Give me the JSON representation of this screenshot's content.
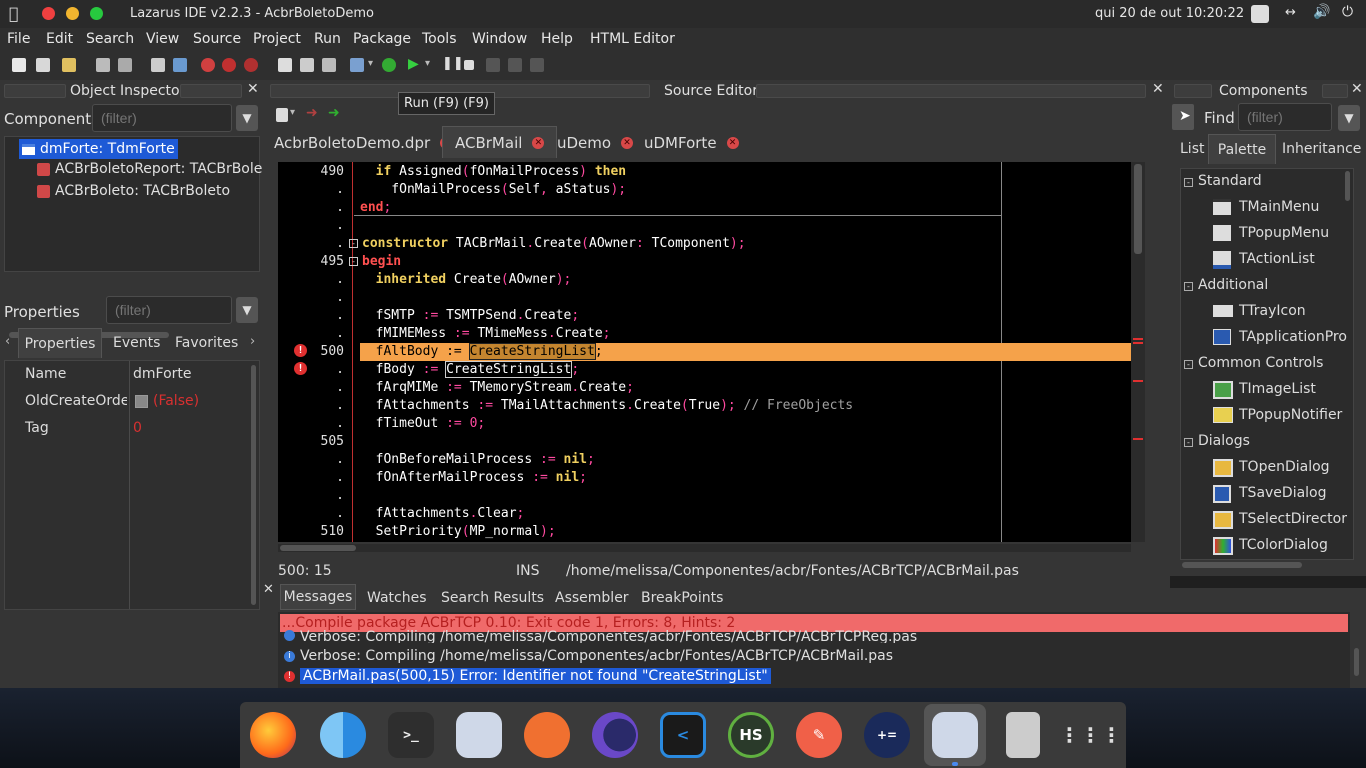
{
  "system": {
    "title": "Lazarus IDE v2.2.3 - AcbrBoletoDemo",
    "datetime": "qui 20 de out  10:20:22"
  },
  "menu": [
    "File",
    "Edit",
    "Search",
    "View",
    "Source",
    "Project",
    "Run",
    "Package",
    "Tools",
    "Window",
    "Help",
    "HTML Editor"
  ],
  "tooltip": "Run (F9) (F9)",
  "object_inspector": {
    "title": "Object Inspector",
    "components_label": "Components",
    "filter_placeholder": "(filter)",
    "tree": [
      "dmForte: TdmForte",
      "ACBrBoletoReport: TACBrBole",
      "ACBrBoleto: TACBrBoleto"
    ],
    "properties_label": "Properties",
    "tabs": [
      "Properties",
      "Events",
      "Favorites"
    ],
    "props": [
      {
        "name": "Name",
        "value": "dmForte"
      },
      {
        "name": "OldCreateOrder",
        "value": "(False)"
      },
      {
        "name": "Tag",
        "value": "0"
      }
    ]
  },
  "source_editor": {
    "title": "Source Editor",
    "tabs": [
      "AcbrBoletoDemo.dpr",
      "ACBrMail",
      "uDemo",
      "uDMForte"
    ],
    "lines": [
      {
        "n": "490",
        "t": "  if Assigned(fOnMailProcess) then"
      },
      {
        "n": ".",
        "t": "    fOnMailProcess(Self, aStatus);"
      },
      {
        "n": ".",
        "t": "end;"
      },
      {
        "n": ".",
        "t": ""
      },
      {
        "n": ".",
        "t": "constructor TACBrMail.Create(AOwner: TComponent);"
      },
      {
        "n": "495",
        "t": "begin"
      },
      {
        "n": ".",
        "t": "  inherited Create(AOwner);"
      },
      {
        "n": ".",
        "t": ""
      },
      {
        "n": ".",
        "t": "  fSMTP := TSMTPSend.Create;"
      },
      {
        "n": ".",
        "t": "  fMIMEMess := TMimeMess.Create;"
      },
      {
        "n": "500",
        "t": "  fAltBody := CreateStringList;"
      },
      {
        "n": ".",
        "t": "  fBody := CreateStringList;"
      },
      {
        "n": ".",
        "t": "  fArqMIMe := TMemoryStream.Create;"
      },
      {
        "n": ".",
        "t": "  fAttachments := TMailAttachments.Create(True); // FreeObjects"
      },
      {
        "n": ".",
        "t": "  fTimeOut := 0;"
      },
      {
        "n": "505",
        "t": ""
      },
      {
        "n": ".",
        "t": "  fOnBeforeMailProcess := nil;"
      },
      {
        "n": ".",
        "t": "  fOnAfterMailProcess := nil;"
      },
      {
        "n": ".",
        "t": ""
      },
      {
        "n": ".",
        "t": "  fAttachments.Clear;"
      },
      {
        "n": "510",
        "t": "  SetPriority(MP_normal);"
      }
    ],
    "status_pos": "500: 15",
    "status_mode": "INS",
    "status_file": "/home/melissa/Componentes/acbr/Fontes/ACBrTCP/ACBrMail.pas"
  },
  "messages": {
    "tabs": [
      "Messages",
      "Watches",
      "Search Results",
      "Assembler",
      "BreakPoints"
    ],
    "header": "...Compile package ACBrTCP 0.10: Exit code 1, Errors: 8, Hints: 2",
    "lines": [
      "Verbose: Compiling /home/melissa/Componentes/acbr/Fontes/ACBrTCP/ACBrTCPReg.pas",
      "Verbose: Compiling /home/melissa/Componentes/acbr/Fontes/ACBrTCP/ACBrMail.pas",
      "ACBrMail.pas(500,15) Error: Identifier not found \"CreateStringList\""
    ]
  },
  "components": {
    "title": "Components",
    "find_label": "Find",
    "filter_placeholder": "(filter)",
    "tabs": [
      "List",
      "Palette",
      "Inheritance"
    ],
    "groups": [
      {
        "name": "Standard",
        "items": [
          "TMainMenu",
          "TPopupMenu",
          "TActionList"
        ]
      },
      {
        "name": "Additional",
        "items": [
          "TTrayIcon",
          "TApplicationPro"
        ]
      },
      {
        "name": "Common Controls",
        "items": [
          "TImageList",
          "TPopupNotifier"
        ]
      },
      {
        "name": "Dialogs",
        "items": [
          "TOpenDialog",
          "TSaveDialog",
          "TSelectDirector",
          "TColorDialog"
        ]
      }
    ]
  },
  "dock": [
    "firefox-icon",
    "finder-icon",
    "terminal-icon",
    "lazarus-icon",
    "inkscape-icon",
    "eclipse-icon",
    "vscode-icon",
    "hs-icon",
    "pen-icon",
    "calculator-icon",
    "lazarus-active-icon",
    "trash-icon",
    "apps-grid-icon"
  ],
  "dock_labels": {
    "terminal": ">_",
    "hs": "HS"
  },
  "colors": {
    "accent": "#1e5ad6",
    "error": "#e03030",
    "highlight": "#f5a24a"
  }
}
